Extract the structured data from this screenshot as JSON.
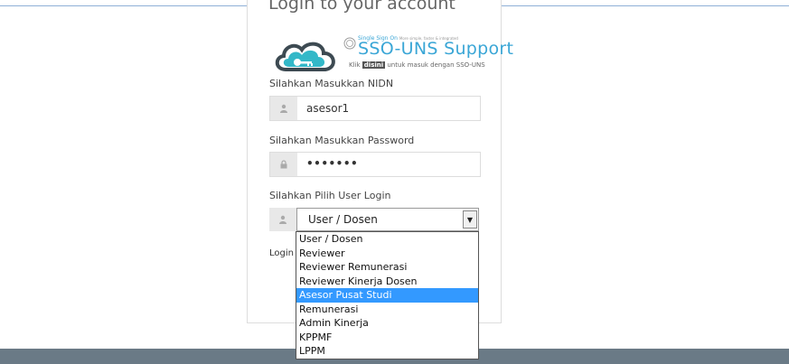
{
  "login": {
    "title": "Login to your account",
    "sso": {
      "top_text": "Single Sign On",
      "tagline": "More simple, faster & integrated",
      "brand": "SSO-UNS Support",
      "sub_prefix": "Klik",
      "sub_link": "disini",
      "sub_suffix": "untuk masuk dengan SSO-UNS"
    },
    "nidn": {
      "label": "Silahkan Masukkan NIDN",
      "value": "asesor1",
      "icon": "user-icon"
    },
    "password": {
      "label": "Silahkan Masukkan Password",
      "value": "•••••••",
      "icon": "lock-icon"
    },
    "user_login": {
      "label": "Silahkan Pilih User Login",
      "selected": "User / Dosen",
      "icon": "user-icon",
      "options": [
        "User / Dosen",
        "Reviewer",
        "Reviewer Remunerasi",
        "Reviewer Kinerja Dosen",
        "Asesor Pusat Studi",
        "Remunerasi",
        "Admin Kinerja",
        "KPPMF",
        "LPPM"
      ],
      "highlighted_index": 4
    },
    "login_prefix": "Login l"
  },
  "colors": {
    "accent": "#3aa6d6",
    "highlight": "#3399ff",
    "footer": "#6a7a86"
  }
}
